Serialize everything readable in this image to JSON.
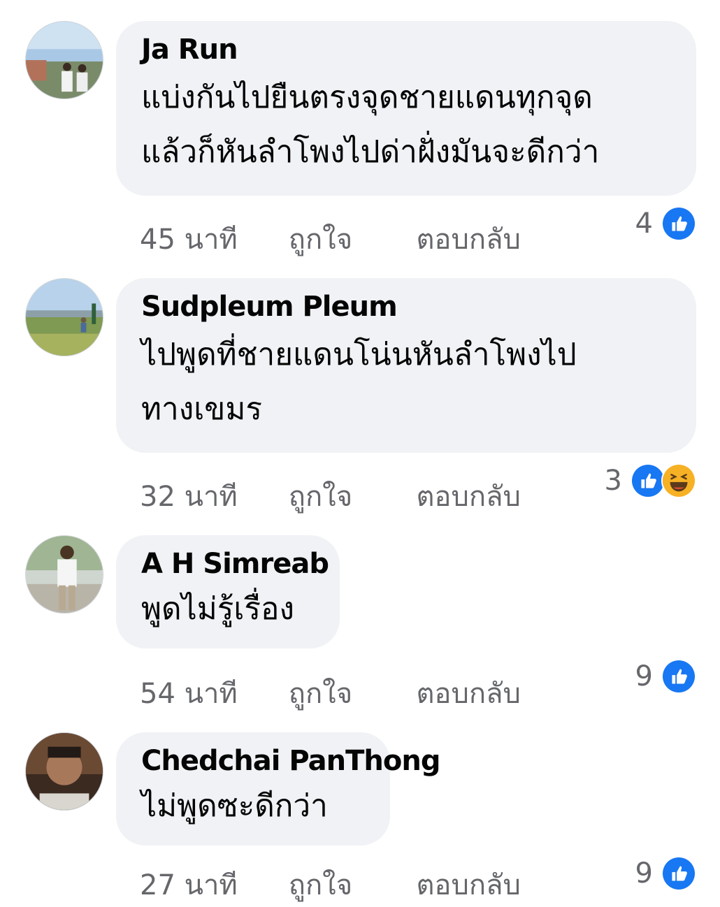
{
  "actions": {
    "like_label": "ถูกใจ",
    "reply_label": "ตอบกลับ"
  },
  "colors": {
    "bubble": "#f0f2f5",
    "muted_text": "#65676b",
    "like_blue": "#1877f2",
    "haha_yellow": "#f7b125"
  },
  "comments": [
    {
      "author": "Ja Run",
      "text_line1": "แบ่งกันไปยืนตรงจุดชายแดนทุกจุด",
      "text_line2": "แล้วก็หันลำโพงไปด่าฝั่งมันจะดีกว่า",
      "time": "45 นาที",
      "reaction_count": "4",
      "reaction_icons": [
        "like-icon"
      ]
    },
    {
      "author": "Sudpleum Pleum",
      "text_line1": "ไปพูดที่ชายแดนโน่นหันลำโพงไป",
      "text_line2": "ทางเขมร",
      "time": "32 นาที",
      "reaction_count": "3",
      "reaction_icons": [
        "like-icon",
        "haha-icon"
      ]
    },
    {
      "author": "A H Simreab",
      "text_line1": "พูดไม่รู้เรื่อง",
      "time": "54 นาที",
      "reaction_count": "9",
      "reaction_icons": [
        "like-icon"
      ]
    },
    {
      "author": "Chedchai PanThong",
      "text_line1": "ไม่พูดซะดีกว่า",
      "time": "27 นาที",
      "reaction_count": "9",
      "reaction_icons": [
        "like-icon"
      ]
    }
  ]
}
